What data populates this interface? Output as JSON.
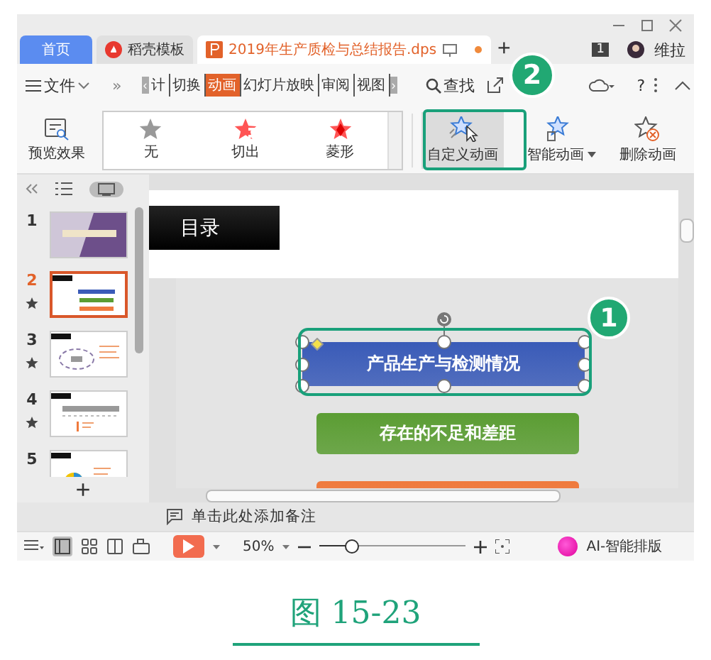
{
  "tabs": [
    {
      "label": "首页",
      "kind": "home",
      "selected": false
    },
    {
      "label": "稻壳模板",
      "kind": "template",
      "selected": false
    },
    {
      "label": "2019年生产质检与总结报告.dps",
      "kind": "document",
      "selected": true,
      "modified": true
    }
  ],
  "new_tab": "+",
  "badge": "1",
  "user": "维拉",
  "menu": {
    "file": "文件",
    "more": "»",
    "prev": "‹",
    "next": "›",
    "search": "查找",
    "help": "?",
    "tabs": [
      {
        "label": "计",
        "selected": false
      },
      {
        "label": "切换",
        "selected": false
      },
      {
        "label": "动画",
        "selected": true
      },
      {
        "label": "幻灯片放映",
        "selected": false
      },
      {
        "label": "审阅",
        "selected": false
      },
      {
        "label": "视图",
        "selected": false
      }
    ]
  },
  "ribbon": {
    "preview": "预览效果",
    "gallery": [
      {
        "label": "无",
        "kind": "none"
      },
      {
        "label": "切出",
        "kind": "cut"
      },
      {
        "label": "菱形",
        "kind": "diamond"
      }
    ],
    "buttons": [
      {
        "label": "自定义动画",
        "kind": "custom",
        "selected": true,
        "dropdown": false
      },
      {
        "label": "智能动画",
        "kind": "smart",
        "selected": false,
        "dropdown": true
      },
      {
        "label": "删除动画",
        "kind": "delete",
        "selected": false,
        "dropdown": false
      }
    ]
  },
  "panel_views": [
    {
      "kind": "outline",
      "selected": false
    },
    {
      "kind": "thumbnails",
      "selected": true
    }
  ],
  "slides": [
    {
      "number": "1",
      "kind": "cover",
      "selected": false,
      "animated": false
    },
    {
      "number": "2",
      "kind": "list",
      "selected": true,
      "animated": true
    },
    {
      "number": "3",
      "kind": "cycle",
      "selected": false,
      "animated": true
    },
    {
      "number": "4",
      "kind": "table",
      "selected": false,
      "animated": true
    },
    {
      "number": "5",
      "kind": "pie",
      "selected": false,
      "animated": false
    }
  ],
  "add_slide": "+",
  "slide": {
    "title": "目录",
    "items": [
      {
        "text": "产品生产与检测情况",
        "color": "#3a5bb8",
        "selected": true
      },
      {
        "text": "存在的不足和差距",
        "color": "#5b9d33",
        "selected": false
      },
      {
        "color": "#ef7a3d",
        "selected": false
      }
    ]
  },
  "callouts": [
    {
      "label": "2"
    },
    {
      "label": "1"
    }
  ],
  "notes": "单击此处添加备注",
  "status": {
    "play_selected": false,
    "zoom": "50%",
    "level": 0.22,
    "ai": "AI-智能排版"
  },
  "caption": "图 15-23"
}
